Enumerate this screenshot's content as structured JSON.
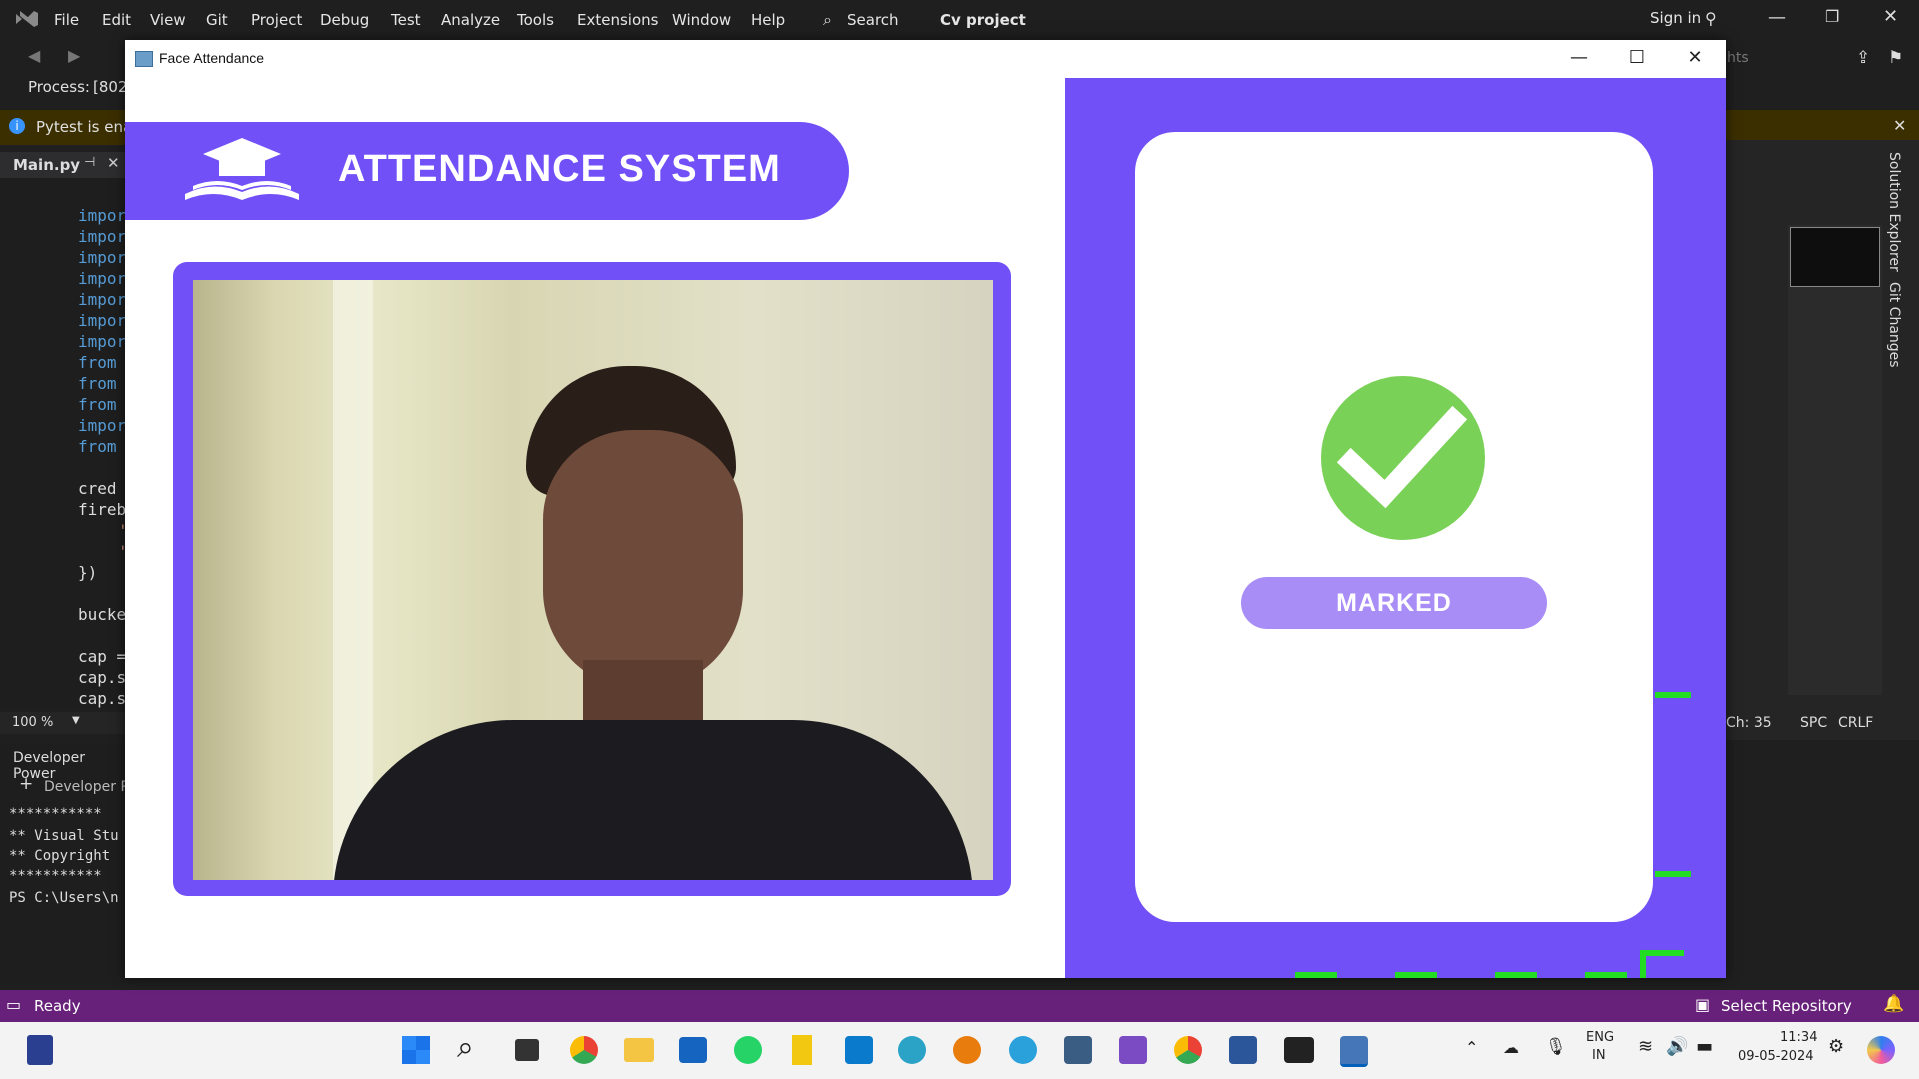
{
  "vs": {
    "menu": [
      "File",
      "Edit",
      "View",
      "Git",
      "Project",
      "Debug",
      "Test",
      "Analyze",
      "Tools",
      "Extensions",
      "Window",
      "Help"
    ],
    "search_label": "Search",
    "solution_name": "Cv project",
    "sign_in": "Sign in",
    "process_label": "Process:",
    "process_value": "[802",
    "info_text": "Pytest is enab",
    "doc_tab": "Main.py",
    "code_lines": [
      "impor",
      "impor",
      "impor",
      "impor",
      "impor",
      "impor",
      "impor",
      "from",
      "from",
      "from",
      "impor",
      "from",
      "",
      "cred",
      "fireb",
      "'",
      "'",
      "})",
      "",
      "bucke",
      "",
      "cap =",
      "cap.s",
      "cap.s"
    ],
    "zoom": "100 %",
    "bottom_panel_title": "Developer Power",
    "bottom_panel_tab": "Developer P",
    "terminal_lines": [
      "***********",
      "** Visual Stu",
      "** Copyright",
      "***********",
      "PS C:\\Users\\n"
    ],
    "status_ready": "Ready",
    "status_select_repo": "Select Repository",
    "pos_ch": "Ch: 35",
    "pos_spc": "SPC",
    "pos_crlf": "CRLF",
    "right_tabs": [
      "Solution Explorer",
      "Git Changes"
    ],
    "toolbar_hint": "hts"
  },
  "app": {
    "window_title": "Face Attendance",
    "banner_title": "ATTENDANCE SYSTEM",
    "status_label": "MARKED",
    "colors": {
      "accent": "#7150f8",
      "check": "#7ad157",
      "pill": "#a98df7"
    }
  },
  "taskbar": {
    "lang": "ENG",
    "region": "IN",
    "time": "11:34",
    "date": "09-05-2024"
  }
}
